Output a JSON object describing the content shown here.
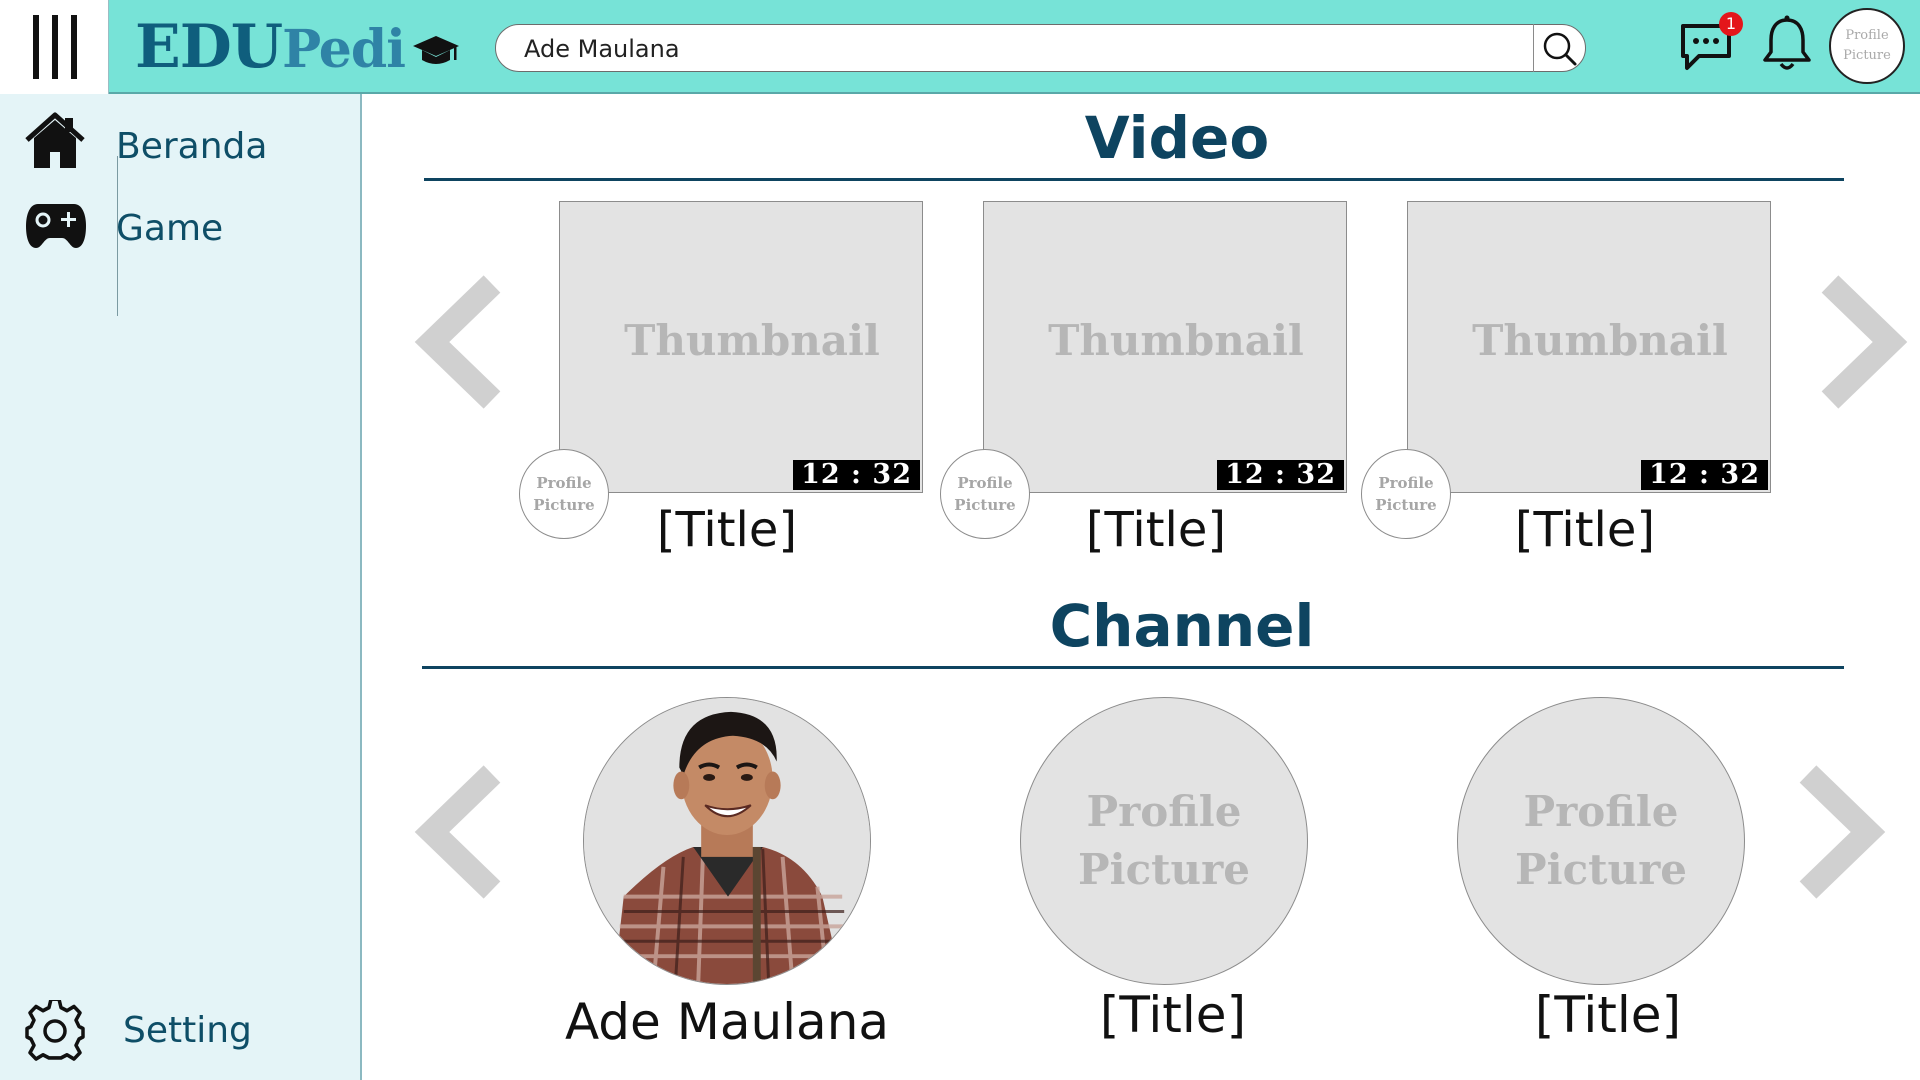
{
  "header": {
    "logo_main": "EDU",
    "logo_sub": "Pedi",
    "search_value": "Ade Maulana",
    "notification_count": "1",
    "avatar_label": "Profile Picture"
  },
  "sidebar": {
    "items": [
      {
        "label": "Beranda",
        "icon": "home-icon"
      },
      {
        "label": "Game",
        "icon": "gamepad-icon"
      }
    ],
    "setting_label": "Setting"
  },
  "video_section": {
    "title": "Video",
    "cards": [
      {
        "thumb_label": "Thumbnail",
        "duration": "12 : 32",
        "avatar_label": "Profile Picture",
        "title": "[Title]"
      },
      {
        "thumb_label": "Thumbnail",
        "duration": "12 : 32",
        "avatar_label": "Profile Picture",
        "title": "[Title]"
      },
      {
        "thumb_label": "Thumbnail",
        "duration": "12 : 32",
        "avatar_label": "Profile Picture",
        "title": "[Title]"
      }
    ]
  },
  "channel_section": {
    "title": "Channel",
    "channels": [
      {
        "name": "Ade Maulana",
        "picture_label": ""
      },
      {
        "name": "[Title]",
        "picture_label": "Profile Picture"
      },
      {
        "name": "[Title]",
        "picture_label": "Profile Picture"
      }
    ]
  },
  "colors": {
    "topbar": "#77e3d7",
    "sidebar": "#e4f4f7",
    "heading": "#0e4460",
    "badge": "#e4161b"
  }
}
